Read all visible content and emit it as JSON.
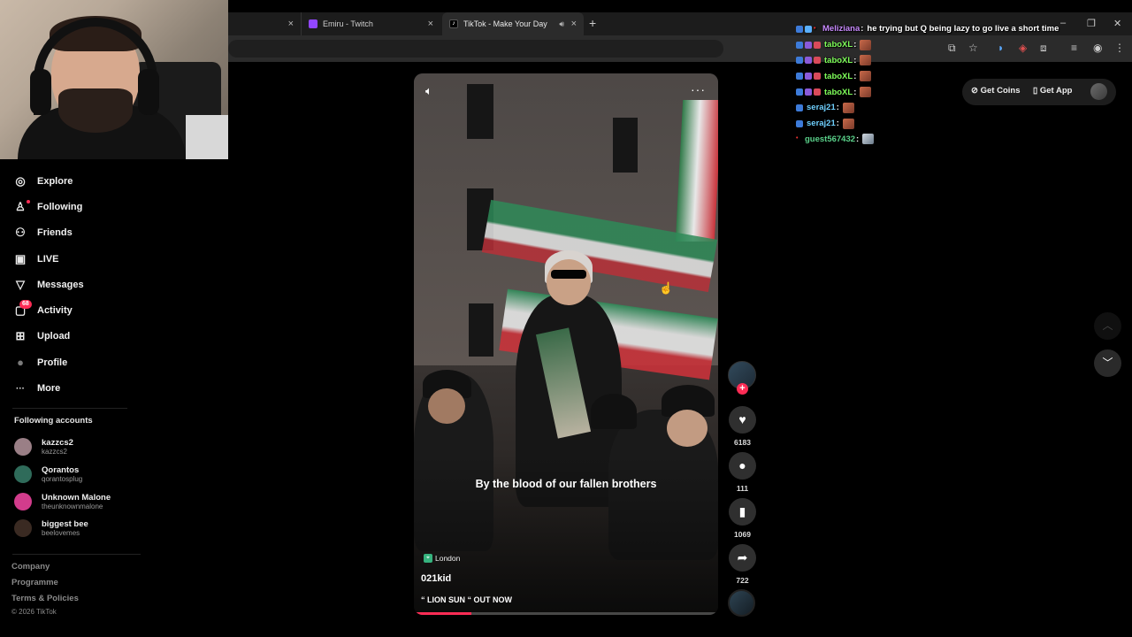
{
  "browser": {
    "tabs": [
      {
        "label": "",
        "close": "×"
      },
      {
        "label": "Emiru - Twitch",
        "close": "×"
      },
      {
        "label": "TikTok - Make Your Day",
        "close": "×",
        "active": true
      }
    ],
    "new_tab": "+",
    "window_controls": {
      "minimize": "–",
      "maximize": "❐",
      "close": "✕"
    }
  },
  "sidebar": {
    "nav": [
      {
        "label": "Explore",
        "icon": "compass-icon",
        "glyph": "◎"
      },
      {
        "label": "Following",
        "icon": "person-icon",
        "glyph": "♙"
      },
      {
        "label": "Friends",
        "icon": "friends-icon",
        "glyph": "⚇"
      },
      {
        "label": "LIVE",
        "icon": "live-icon",
        "glyph": "▣"
      },
      {
        "label": "Messages",
        "icon": "messages-icon",
        "glyph": "▽"
      },
      {
        "label": "Activity",
        "icon": "activity-icon",
        "glyph": "▢",
        "badge": "68"
      },
      {
        "label": "Upload",
        "icon": "upload-icon",
        "glyph": "⊞"
      },
      {
        "label": "Profile",
        "icon": "profile-avatar",
        "glyph": "●"
      },
      {
        "label": "More",
        "icon": "more-icon",
        "glyph": "···"
      }
    ],
    "following_title": "Following accounts",
    "following": [
      {
        "name": "kazzcs2",
        "handle": "kazzcs2",
        "color": "#9a7f86"
      },
      {
        "name": "Qorantos",
        "handle": "qorantosplug",
        "color": "#2f6b5a"
      },
      {
        "name": "Unknown Malone",
        "handle": "theunknownmalone",
        "color": "#d23c8c"
      },
      {
        "name": "biggest bee",
        "handle": "beelovemes",
        "color": "#3a2a22"
      }
    ],
    "footer_links": [
      "Company",
      "Programme",
      "Terms & Policies"
    ],
    "copyright": "© 2026 TikTok"
  },
  "video": {
    "caption": "By the blood of our fallen brothers",
    "location": "London",
    "author": "021kid",
    "description": "“ LION SUN “ OUT NOW",
    "progress": 0.19
  },
  "actions": {
    "likes": "6183",
    "comments": "111",
    "saves": "1069",
    "shares": "722"
  },
  "top_buttons": {
    "get_coins": "Get Coins",
    "get_app": "Get App"
  },
  "chat": [
    {
      "user": "Meliziana",
      "color": "#c98bff",
      "msg": "he trying but Q being lazy to go live a short time",
      "emote": false
    },
    {
      "user": "taboXL",
      "color": "#7fff5a",
      "msg": "",
      "emote": true
    },
    {
      "user": "taboXL",
      "color": "#7fff5a",
      "msg": "",
      "emote": true
    },
    {
      "user": "taboXL",
      "color": "#7fff5a",
      "msg": "",
      "emote": true
    },
    {
      "user": "taboXL",
      "color": "#7fff5a",
      "msg": "",
      "emote": true
    },
    {
      "user": "seraj21",
      "color": "#6fd0ff",
      "msg": "",
      "emote": true
    },
    {
      "user": "seraj21",
      "color": "#6fd0ff",
      "msg": "",
      "emote": true
    },
    {
      "user": "guest567432",
      "color": "#5ad18a",
      "msg": "",
      "emote": true
    }
  ],
  "colors": {
    "accent": "#fe2c55",
    "bg": "#000000"
  }
}
